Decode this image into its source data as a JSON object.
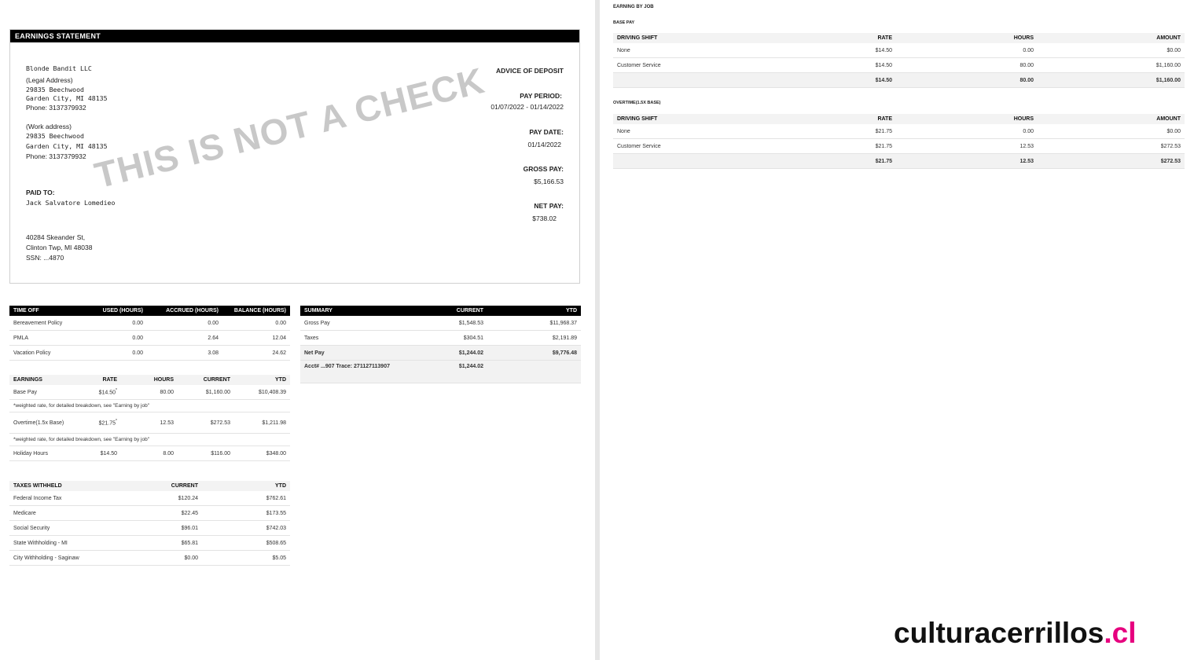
{
  "statement": {
    "header": "EARNINGS STATEMENT",
    "watermark": "THIS IS NOT A CHECK",
    "company": "Blonde Bandit LLC",
    "legal_label": "(Legal Address)",
    "legal_street": "29835 Beechwood",
    "legal_city": "Garden City, MI 48135",
    "legal_phone": "Phone: 3137379932",
    "work_label": "(Work address)",
    "work_street": "29835 Beechwood",
    "work_city": "Garden City, MI 48135",
    "work_phone": "Phone: 3137379932",
    "paid_to_label": "PAID TO:",
    "employee": "Jack Salvatore Lomedieo",
    "emp_street": "40284 Skeander St,",
    "emp_city": "Clinton Twp, MI 48038",
    "ssn": "SSN: ...4870",
    "advice": "ADVICE OF DEPOSIT",
    "pay_period_label": "PAY PERIOD:",
    "pay_period": "01/07/2022 - 01/14/2022",
    "pay_date_label": "PAY DATE:",
    "pay_date": "01/14/2022",
    "gross_label": "GROSS PAY:",
    "gross": "$5,166.53",
    "net_label": "NET PAY:",
    "net": "$738.02"
  },
  "time_off": {
    "headers": [
      "TIME OFF",
      "USED (HOURS)",
      "ACCRUED (HOURS)",
      "BALANCE (HOURS)"
    ],
    "rows": [
      [
        "Bereavement Policy",
        "0.00",
        "0.00",
        "0.00"
      ],
      [
        "PMLA",
        "0.00",
        "2.64",
        "12.04"
      ],
      [
        "Vacation Policy",
        "0.00",
        "3.08",
        "24.62"
      ]
    ]
  },
  "earnings": {
    "headers": [
      "EARNINGS",
      "RATE",
      "HOURS",
      "CURRENT",
      "YTD"
    ],
    "rows": [
      [
        "Base Pay",
        "$14.50",
        "80.00",
        "$1,160.00",
        "$10,408.39"
      ],
      [
        "Overtime(1.5x Base)",
        "$21.75",
        "12.53",
        "$272.53",
        "$1,211.98"
      ],
      [
        "Holiday Hours",
        "$14.50",
        "8.00",
        "$116.00",
        "$348.00"
      ]
    ],
    "note": "*weighted rate, for detailed breakdown, see \"Earning by job\"",
    "asterisk": "*"
  },
  "taxes": {
    "headers": [
      "TAXES WITHHELD",
      "CURRENT",
      "YTD"
    ],
    "rows": [
      [
        "Federal Income Tax",
        "$120.24",
        "$762.61"
      ],
      [
        "Medicare",
        "$22.45",
        "$173.55"
      ],
      [
        "Social Security",
        "$96.01",
        "$742.03"
      ],
      [
        "State Withholding - MI",
        "$65.81",
        "$508.65"
      ],
      [
        "City Withholding - Saginaw",
        "$0.00",
        "$5.05"
      ]
    ]
  },
  "summary": {
    "headers": [
      "SUMMARY",
      "CURRENT",
      "YTD"
    ],
    "rows": [
      [
        "Gross Pay",
        "$1,548.53",
        "$11,968.37"
      ],
      [
        "Taxes",
        "$304.51",
        "$2,191.89"
      ],
      [
        "Net Pay",
        "$1,244.02",
        "$9,776.48"
      ],
      [
        "Acct# ...907 Trace: 271127113907",
        "$1,244.02",
        ""
      ]
    ]
  },
  "by_job": {
    "title": "EARNING BY JOB",
    "base_label": "BASE PAY",
    "overtime_label": "OVERTIME(1.5X BASE)",
    "headers": [
      "DRIVING SHIFT",
      "RATE",
      "HOURS",
      "AMOUNT"
    ],
    "base_rows": [
      [
        "None",
        "$14.50",
        "0.00",
        "$0.00"
      ],
      [
        "Customer Service",
        "$14.50",
        "80.00",
        "$1,160.00"
      ],
      [
        "",
        "$14.50",
        "80.00",
        "$1,160.00"
      ]
    ],
    "overtime_rows": [
      [
        "None",
        "$21.75",
        "0.00",
        "$0.00"
      ],
      [
        "Customer Service",
        "$21.75",
        "12.53",
        "$272.53"
      ],
      [
        "",
        "$21.75",
        "12.53",
        "$272.53"
      ]
    ]
  },
  "logo": {
    "text": "culturacerrillos",
    "tld": ".cl",
    "accent": "#e6007e"
  }
}
